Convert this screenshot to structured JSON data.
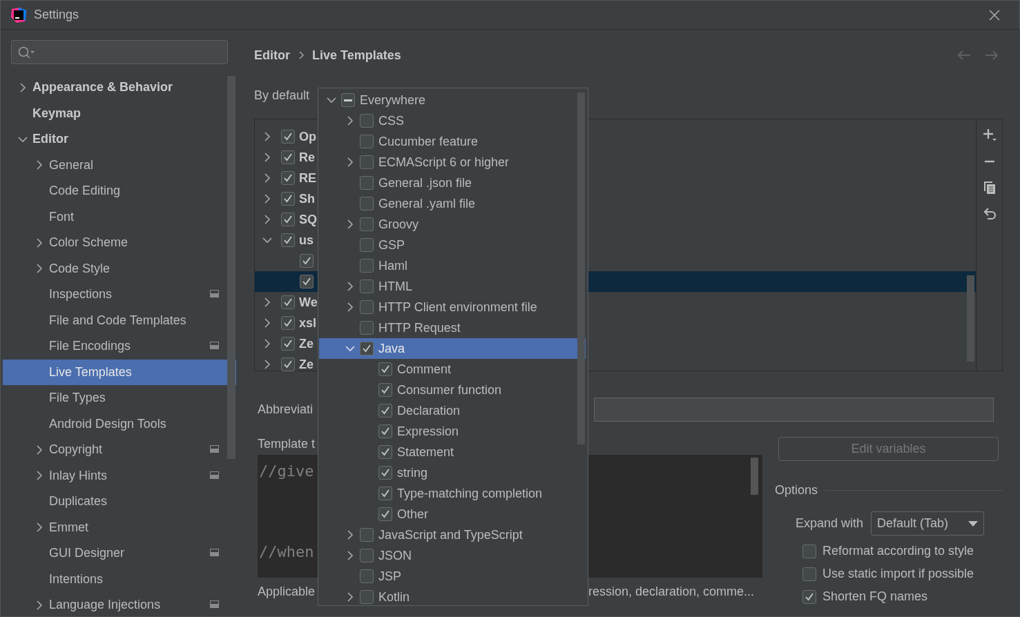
{
  "window": {
    "title": "Settings"
  },
  "sidebar": {
    "items": [
      {
        "label": "Appearance & Behavior",
        "expanded": false,
        "selected": false
      },
      {
        "label": "Keymap",
        "selected": false
      },
      {
        "label": "Editor",
        "expanded": true,
        "selected": false,
        "children": [
          {
            "label": "General",
            "expanded": false,
            "selected": false
          },
          {
            "label": "Code Editing",
            "selected": false
          },
          {
            "label": "Font",
            "selected": false
          },
          {
            "label": "Color Scheme",
            "expanded": false,
            "selected": false
          },
          {
            "label": "Code Style",
            "expanded": false,
            "selected": false
          },
          {
            "label": "Inspections",
            "selected": false,
            "scoped": true
          },
          {
            "label": "File and Code Templates",
            "selected": false
          },
          {
            "label": "File Encodings",
            "selected": false,
            "scoped": true
          },
          {
            "label": "Live Templates",
            "selected": true
          },
          {
            "label": "File Types",
            "selected": false
          },
          {
            "label": "Android Design Tools",
            "selected": false
          },
          {
            "label": "Copyright",
            "expanded": false,
            "selected": false,
            "scoped": true
          },
          {
            "label": "Inlay Hints",
            "expanded": false,
            "selected": false,
            "scoped": true
          },
          {
            "label": "Duplicates",
            "selected": false
          },
          {
            "label": "Emmet",
            "expanded": false,
            "selected": false
          },
          {
            "label": "GUI Designer",
            "selected": false,
            "scoped": true
          },
          {
            "label": "Intentions",
            "selected": false
          },
          {
            "label": "Language Injections",
            "expanded": false,
            "selected": false,
            "scoped": true
          }
        ]
      }
    ]
  },
  "breadcrumb": [
    "Editor",
    "Live Templates"
  ],
  "nav": {
    "back_disabled": true,
    "forward_disabled": true
  },
  "by_default_label": "By default",
  "templates": [
    {
      "label": "Op",
      "checked": true,
      "expanded": false
    },
    {
      "label": "Re",
      "checked": true,
      "expanded": false
    },
    {
      "label": "RE",
      "checked": true,
      "expanded": false
    },
    {
      "label": "Sh",
      "checked": true,
      "expanded": false
    },
    {
      "label": "SQ",
      "checked": true,
      "expanded": false
    },
    {
      "label": "us",
      "checked": true,
      "expanded": true,
      "children": [
        {
          "checked": true,
          "selected": false
        },
        {
          "checked": true,
          "selected": true
        }
      ]
    },
    {
      "label": "We",
      "checked": true,
      "expanded": false
    },
    {
      "label": "xsl",
      "checked": true,
      "expanded": false
    },
    {
      "label": "Ze",
      "checked": true,
      "expanded": false
    },
    {
      "label": "Ze",
      "checked": true,
      "expanded": false
    }
  ],
  "abbreviation": {
    "label": "Abbreviati"
  },
  "template_text": {
    "label": "Template t",
    "lines": [
      "//give",
      "//when"
    ]
  },
  "applicable": {
    "label": "Applicable",
    "value": "ression, declaration, comme..."
  },
  "edit_variables": {
    "label": "Edit variables",
    "disabled": true
  },
  "options": {
    "title": "Options",
    "expand_label": "Expand with",
    "expand_value": "Default (Tab)",
    "checkboxes": [
      {
        "label": "Reformat according to style",
        "checked": false
      },
      {
        "label": "Use static import if possible",
        "checked": false
      },
      {
        "label": "Shorten FQ names",
        "checked": true
      }
    ]
  },
  "context_popup": {
    "items": [
      {
        "label": "Everywhere",
        "partial": true,
        "expanded": true,
        "selected": false,
        "children": [
          {
            "label": "CSS",
            "checked": false,
            "expanded": false,
            "selected": false
          },
          {
            "label": "Cucumber feature",
            "checked": false,
            "selected": false
          },
          {
            "label": "ECMAScript 6 or higher",
            "checked": false,
            "expanded": false,
            "selected": false
          },
          {
            "label": "General .json file",
            "checked": false,
            "selected": false
          },
          {
            "label": "General .yaml file",
            "checked": false,
            "selected": false
          },
          {
            "label": "Groovy",
            "checked": false,
            "expanded": false,
            "selected": false
          },
          {
            "label": "GSP",
            "checked": false,
            "selected": false
          },
          {
            "label": "Haml",
            "checked": false,
            "selected": false
          },
          {
            "label": "HTML",
            "checked": false,
            "expanded": false,
            "selected": false
          },
          {
            "label": "HTTP Client environment file",
            "checked": false,
            "expanded": false,
            "selected": false
          },
          {
            "label": "HTTP Request",
            "checked": false,
            "selected": false
          },
          {
            "label": "Java",
            "checked": true,
            "expanded": true,
            "selected": true,
            "children": [
              {
                "label": "Comment",
                "checked": true,
                "selected": false
              },
              {
                "label": "Consumer function",
                "checked": true,
                "selected": false
              },
              {
                "label": "Declaration",
                "checked": true,
                "selected": false
              },
              {
                "label": "Expression",
                "checked": true,
                "selected": false
              },
              {
                "label": "Statement",
                "checked": true,
                "selected": false
              },
              {
                "label": "string",
                "checked": true,
                "selected": false
              },
              {
                "label": "Type-matching completion",
                "checked": true,
                "selected": false
              },
              {
                "label": "Other",
                "checked": true,
                "selected": false
              }
            ]
          },
          {
            "label": "JavaScript and TypeScript",
            "checked": false,
            "expanded": false,
            "selected": false
          },
          {
            "label": "JSON",
            "checked": false,
            "expanded": false,
            "selected": false
          },
          {
            "label": "JSP",
            "checked": false,
            "selected": false
          },
          {
            "label": "Kotlin",
            "checked": false,
            "expanded": false,
            "selected": false
          }
        ]
      }
    ]
  }
}
